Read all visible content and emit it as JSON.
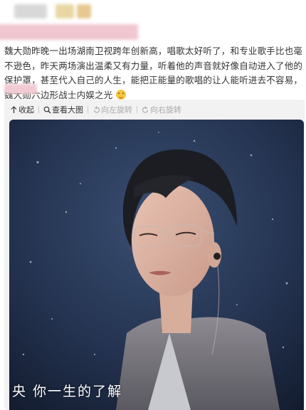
{
  "post": {
    "text": "魏大勋昨晚一出场湖南卫视跨年创新高，唱歌太好听了，和专业歌手比也毫不逊色，昨天两场演出温柔又有力量，听着他的声音就好像自动进入了他的保护罩，甚至代入自己的人生，能把正能量的歌唱的让人能听进去不容易，魏大勋六边形战士内娱之光"
  },
  "toolbar": {
    "collapse_label": "收起",
    "view_large_label": "查看大图",
    "rotate_left_label": "向左旋转",
    "rotate_right_label": "向右旋转"
  },
  "image": {
    "subtitle": "央 你一生的了解"
  },
  "colors": {
    "photo_bg": "#22304a",
    "text": "#333333",
    "toolbar_disabled": "#aaaaaa"
  }
}
